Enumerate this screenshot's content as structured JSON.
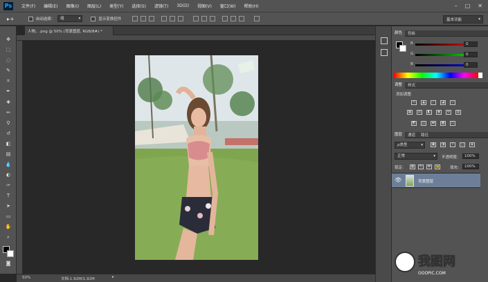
{
  "app": {
    "logo": "Ps"
  },
  "menu": [
    "文件(F)",
    "编辑(E)",
    "图像(I)",
    "图层(L)",
    "类型(Y)",
    "选择(S)",
    "滤镜(T)",
    "3D(D)",
    "视图(V)",
    "窗口(W)",
    "帮助(H)"
  ],
  "options": {
    "auto_select_label": "自动选择：",
    "auto_select_value": "组",
    "show_transform_label": "显示变换控件",
    "workspace": "基本功能"
  },
  "document": {
    "tab_title": "人物，.png @ 50% (背景图层, RGB/8#) *"
  },
  "status": {
    "zoom": "50%",
    "doc_info": "文档:1.92M/1.92M"
  },
  "color_panel": {
    "tabs": [
      "颜色",
      "色板"
    ],
    "channels": [
      {
        "label": "R",
        "value": "0"
      },
      {
        "label": "G",
        "value": "0"
      },
      {
        "label": "B",
        "value": "0"
      }
    ]
  },
  "adjustments_panel": {
    "tabs": [
      "调整",
      "样式"
    ],
    "title": "添加调整"
  },
  "layers_panel": {
    "tabs": [
      "图层",
      "通道",
      "路径"
    ],
    "filter_label": "ρ类型",
    "blend_mode": "正常",
    "opacity_label": "不透明度:",
    "opacity_value": "100%",
    "lock_label": "锁定:",
    "fill_label": "填充:",
    "fill_value": "100%",
    "layers": [
      {
        "name": "背景图层"
      }
    ]
  },
  "watermark": {
    "text": "我图网",
    "sub": "OOOPIC.COM"
  },
  "colors": {
    "ui_bg": "#535353",
    "canvas_bg": "#282828",
    "selected_layer": "#6d7f98"
  }
}
